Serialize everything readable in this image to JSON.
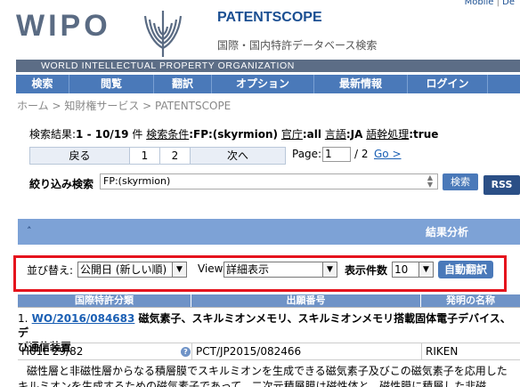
{
  "header": {
    "logo_text": "WIPO",
    "site_title": "PATENTSCOPE",
    "subtitle": "国際・国内特許データベース検索",
    "org_name": "WORLD INTELLECTUAL PROPERTY ORGANIZATION",
    "top_links": [
      "Mobile",
      "De"
    ]
  },
  "nav": {
    "items": [
      "検索",
      "閲覧",
      "翻訳",
      "オプション",
      "最新情報",
      "ログイン"
    ]
  },
  "breadcrumb": [
    "ホーム",
    "知財権サービス",
    "PATENTSCOPE"
  ],
  "search": {
    "result_label": "検索結果:",
    "result_range": "1 - 10/19",
    "result_unit": "件",
    "cond_label": "検索条件",
    "cond_value": ":FP:(skyrmion)",
    "office_label": "官庁",
    "office_value": ":all",
    "lang_label": "言語",
    "lang_value": ":JA",
    "stem_label": "語幹処理",
    "stem_value": ":true"
  },
  "pager": {
    "prev_label": "戻る",
    "pages": [
      "1",
      "2"
    ],
    "next_label": "次へ",
    "page_label": "Page:",
    "page_value": "1",
    "page_total": "/ 2",
    "go_label": "Go >"
  },
  "refine": {
    "label": "絞り込み検索",
    "value": "FP:(skyrmion)",
    "search_button": "検索",
    "rss_button": "RSS"
  },
  "results_panel": {
    "title": "結果分析"
  },
  "sort": {
    "label": "並び替え:",
    "value": "公開日 (新しい順)",
    "view_label": "View",
    "view_value": "詳細表示",
    "count_label": "表示件数",
    "count_value": "10",
    "auto_translate": "自動翻訳"
  },
  "table": {
    "headers": [
      "国際特許分類",
      "出願番号",
      "発明の名称"
    ],
    "rows": [
      {
        "index": "1.",
        "pub_number": "WO/2016/084683",
        "title_line1": "磁気素子、スキルミオンメモリ、スキルミオンメモリ搭載固体電子デバイス、デ",
        "title_line2": "び通信装置",
        "ipc": "H01L 29/82",
        "application_number": "PCT/JP2015/082466",
        "applicant": "RIKEN",
        "abstract_line1": "磁性層と非磁性層からなる積層膜でスキルミオンを生成できる磁気素子及びこの磁気素子を応用した",
        "abstract_line2": "キルミオンを生成するための磁気素子であって、二次元積層膜は磁性体と、磁性膜に積層した非磁"
      }
    ]
  },
  "colors": {
    "nav_bg": "#4a79b9",
    "org_bar": "#5c6d86",
    "highlight_border": "#e5131d",
    "results_bar": "#7da2d6"
  }
}
